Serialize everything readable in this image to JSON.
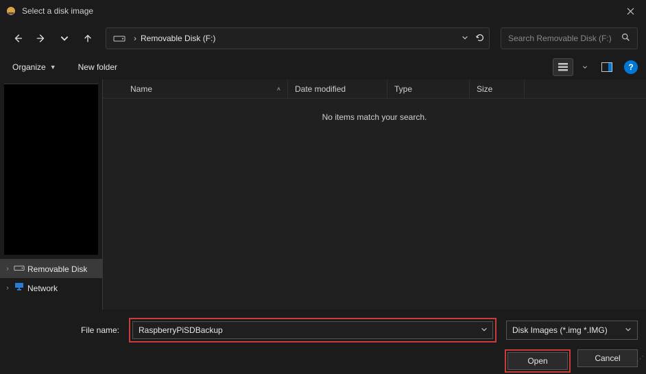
{
  "titlebar": {
    "title": "Select a disk image"
  },
  "nav": {
    "breadcrumb": {
      "root_chevron": "›",
      "location": "Removable Disk (F:)"
    },
    "search_placeholder": "Search Removable Disk (F:)"
  },
  "toolbar": {
    "organize": "Organize",
    "new_folder": "New folder"
  },
  "tree": {
    "items": [
      {
        "label": "Removable Disk",
        "selected": true,
        "icon": "drive"
      },
      {
        "label": "Network",
        "selected": false,
        "icon": "network"
      }
    ]
  },
  "columns": {
    "name": "Name",
    "date": "Date modified",
    "type": "Type",
    "size": "Size"
  },
  "empty_message": "No items match your search.",
  "bottom": {
    "filename_label": "File name:",
    "filename_value": "RaspberryPiSDBackup",
    "filter_label": "Disk Images (*.img *.IMG)",
    "open": "Open",
    "cancel": "Cancel"
  },
  "colors": {
    "highlight": "#cc3a3a",
    "accent": "#0078d4"
  }
}
